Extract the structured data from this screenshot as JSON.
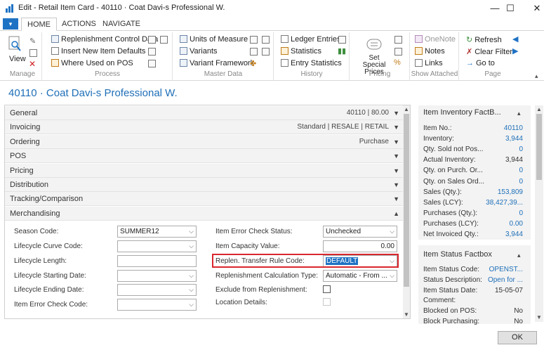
{
  "window": {
    "title": "Edit - Retail Item Card - 40110 · Coat Davi-s Professional W.",
    "minimize": "—",
    "maximize": "☐",
    "close": "✕"
  },
  "tabs": {
    "menu": "▾",
    "home": "HOME",
    "actions": "ACTIONS",
    "navigate": "NAVIGATE"
  },
  "ribbon": {
    "manage": {
      "label": "Manage",
      "view": "View"
    },
    "process": {
      "label": "Process",
      "items": [
        "Replenishment Control Data",
        "Insert New Item Defaults",
        "Where Used on POS"
      ]
    },
    "master": {
      "label": "Master Data",
      "items": [
        "Units of Measure",
        "Variants",
        "Variant Framework"
      ]
    },
    "history": {
      "label": "History",
      "items": [
        "Ledger Entries",
        "Statistics",
        "Entry Statistics"
      ]
    },
    "pricing": {
      "label": "Pricing",
      "special": "Set Special Prices"
    },
    "attached": {
      "label": "Show Attached",
      "items": [
        "OneNote",
        "Notes",
        "Links"
      ]
    },
    "page": {
      "label": "Page",
      "items": [
        "Refresh",
        "Clear Filter",
        "Go to"
      ]
    }
  },
  "page_title": "40110 · Coat Davi-s Professional W.",
  "fasttabs": [
    {
      "title": "General",
      "info": "40110   |   80.00"
    },
    {
      "title": "Invoicing",
      "info": "Standard   |   RESALE   |   RETAIL"
    },
    {
      "title": "Ordering",
      "info": "Purchase"
    },
    {
      "title": "POS",
      "info": ""
    },
    {
      "title": "Pricing",
      "info": ""
    },
    {
      "title": "Distribution",
      "info": ""
    },
    {
      "title": "Tracking/Comparison",
      "info": ""
    },
    {
      "title": "Merchandising",
      "info": ""
    }
  ],
  "merch": {
    "left": [
      {
        "label": "Season Code:",
        "value": "SUMMER12"
      },
      {
        "label": "Lifecycle Curve Code:",
        "value": ""
      },
      {
        "label": "Lifecycle Length:",
        "value": ""
      },
      {
        "label": "Lifecycle Starting Date:",
        "value": ""
      },
      {
        "label": "Lifecycle Ending Date:",
        "value": ""
      },
      {
        "label": "Item Error Check Code:",
        "value": ""
      }
    ],
    "right": [
      {
        "label": "Item Error Check Status:",
        "value": "Unchecked"
      },
      {
        "label": "Item Capacity Value:",
        "value": "0.00"
      },
      {
        "label": "Replen. Transfer Rule Code:",
        "value": "DEFAULT"
      },
      {
        "label": "Replenishment Calculation Type:",
        "value": "Automatic - From ..."
      },
      {
        "label": "Exclude from Replenishment:",
        "value": ""
      },
      {
        "label": "Location Details:",
        "value": ""
      }
    ]
  },
  "inventory_factbox": {
    "title": "Item Inventory FactB...",
    "rows": [
      {
        "label": "Item No.:",
        "value": "40110",
        "color": "#1e6fb8"
      },
      {
        "label": "Inventory:",
        "value": "3,944",
        "color": "#1e6fb8"
      },
      {
        "label": "Qty. Sold not Pos...",
        "value": "0",
        "color": "#1e6fb8"
      },
      {
        "label": "Actual Inventory:",
        "value": "3,944",
        "color": "#333333"
      },
      {
        "label": "Qty. on Purch. Or...",
        "value": "0",
        "color": "#1e6fb8"
      },
      {
        "label": "Qty. on Sales Ord...",
        "value": "0",
        "color": "#1e6fb8"
      },
      {
        "label": "Sales (Qty.):",
        "value": "153,809",
        "color": "#1e6fb8"
      },
      {
        "label": "Sales (LCY):",
        "value": "38,427,39...",
        "color": "#1e6fb8"
      },
      {
        "label": "Purchases (Qty.):",
        "value": "0",
        "color": "#1e6fb8"
      },
      {
        "label": "Purchases (LCY):",
        "value": "0.00",
        "color": "#1e6fb8"
      },
      {
        "label": "Net Invoiced Qty.:",
        "value": "3,944",
        "color": "#1e6fb8"
      }
    ]
  },
  "status_factbox": {
    "title": "Item Status Factbox",
    "rows": [
      {
        "label": "Item Status Code:",
        "value": "OPENST...",
        "color": "#1e6fb8"
      },
      {
        "label": "Status Description:",
        "value": "Open for ...",
        "color": "#1e6fb8"
      },
      {
        "label": "Item Status Date:",
        "value": "15-05-07",
        "color": "#333333"
      },
      {
        "label": "Comment:",
        "value": "",
        "color": "#333333"
      },
      {
        "label": "Blocked on POS:",
        "value": "No",
        "color": "#333333"
      },
      {
        "label": "Block Purchasing:",
        "value": "No",
        "color": "#333333"
      }
    ]
  },
  "ok_button": "OK"
}
